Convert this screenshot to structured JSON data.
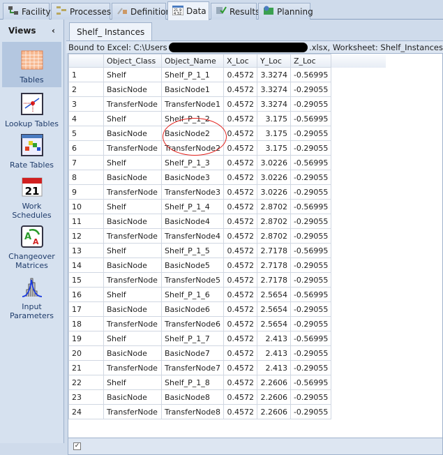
{
  "tabs": [
    {
      "label": "Facility",
      "icon": "facility-icon"
    },
    {
      "label": "Processes",
      "icon": "processes-icon"
    },
    {
      "label": "Definitions",
      "icon": "definitions-icon"
    },
    {
      "label": "Data",
      "icon": "data-icon",
      "active": true
    },
    {
      "label": "Results",
      "icon": "results-icon"
    },
    {
      "label": "Planning",
      "icon": "planning-icon"
    }
  ],
  "sidebar": {
    "title": "Views",
    "collapse": "‹",
    "items": [
      {
        "label": "Tables",
        "selected": true
      },
      {
        "label": "Lookup Tables"
      },
      {
        "label": "Rate Tables"
      },
      {
        "label": "Work Schedules"
      },
      {
        "label": "Changeover Matrices"
      },
      {
        "label": "Input Parameters"
      }
    ]
  },
  "main": {
    "tab": "Shelf_ Instances",
    "bound_prefix": "Bound to Excel: C:\\Users",
    "bound_suffix": ".xlsx, Worksheet: Shelf_Instances",
    "columns": [
      "",
      "Object_Class",
      "Object_Name",
      "X_Loc",
      "Y_Loc",
      "Z_Loc"
    ],
    "rows": [
      [
        "1",
        "Shelf",
        "Shelf_P_1_1",
        "0.4572",
        "3.3274",
        "-0.56995"
      ],
      [
        "2",
        "BasicNode",
        "BasicNode1",
        "0.4572",
        "3.3274",
        "-0.29055"
      ],
      [
        "3",
        "TransferNode",
        "TransferNode1",
        "0.4572",
        "3.3274",
        "-0.29055"
      ],
      [
        "4",
        "Shelf",
        "Shelf_P_1_2",
        "0.4572",
        "3.175",
        "-0.56995"
      ],
      [
        "5",
        "BasicNode",
        "BasicNode2",
        "0.4572",
        "3.175",
        "-0.29055"
      ],
      [
        "6",
        "TransferNode",
        "TransferNode2",
        "0.4572",
        "3.175",
        "-0.29055"
      ],
      [
        "7",
        "Shelf",
        "Shelf_P_1_3",
        "0.4572",
        "3.0226",
        "-0.56995"
      ],
      [
        "8",
        "BasicNode",
        "BasicNode3",
        "0.4572",
        "3.0226",
        "-0.29055"
      ],
      [
        "9",
        "TransferNode",
        "TransferNode3",
        "0.4572",
        "3.0226",
        "-0.29055"
      ],
      [
        "10",
        "Shelf",
        "Shelf_P_1_4",
        "0.4572",
        "2.8702",
        "-0.56995"
      ],
      [
        "11",
        "BasicNode",
        "BasicNode4",
        "0.4572",
        "2.8702",
        "-0.29055"
      ],
      [
        "12",
        "TransferNode",
        "TransferNode4",
        "0.4572",
        "2.8702",
        "-0.29055"
      ],
      [
        "13",
        "Shelf",
        "Shelf_P_1_5",
        "0.4572",
        "2.7178",
        "-0.56995"
      ],
      [
        "14",
        "BasicNode",
        "BasicNode5",
        "0.4572",
        "2.7178",
        "-0.29055"
      ],
      [
        "15",
        "TransferNode",
        "TransferNode5",
        "0.4572",
        "2.7178",
        "-0.29055"
      ],
      [
        "16",
        "Shelf",
        "Shelf_P_1_6",
        "0.4572",
        "2.5654",
        "-0.56995"
      ],
      [
        "17",
        "BasicNode",
        "BasicNode6",
        "0.4572",
        "2.5654",
        "-0.29055"
      ],
      [
        "18",
        "TransferNode",
        "TransferNode6",
        "0.4572",
        "2.5654",
        "-0.29055"
      ],
      [
        "19",
        "Shelf",
        "Shelf_P_1_7",
        "0.4572",
        "2.413",
        "-0.56995"
      ],
      [
        "20",
        "BasicNode",
        "BasicNode7",
        "0.4572",
        "2.413",
        "-0.29055"
      ],
      [
        "21",
        "TransferNode",
        "TransferNode7",
        "0.4572",
        "2.413",
        "-0.29055"
      ],
      [
        "22",
        "Shelf",
        "Shelf_P_1_8",
        "0.4572",
        "2.2606",
        "-0.56995"
      ],
      [
        "23",
        "BasicNode",
        "BasicNode8",
        "0.4572",
        "2.2606",
        "-0.29055"
      ],
      [
        "24",
        "TransferNode",
        "TransferNode8",
        "0.4572",
        "2.2606",
        "-0.29055"
      ]
    ],
    "footer_check": "✓"
  },
  "colors": {
    "annotation": "#e3201b",
    "accent": "#b4c7e0"
  }
}
